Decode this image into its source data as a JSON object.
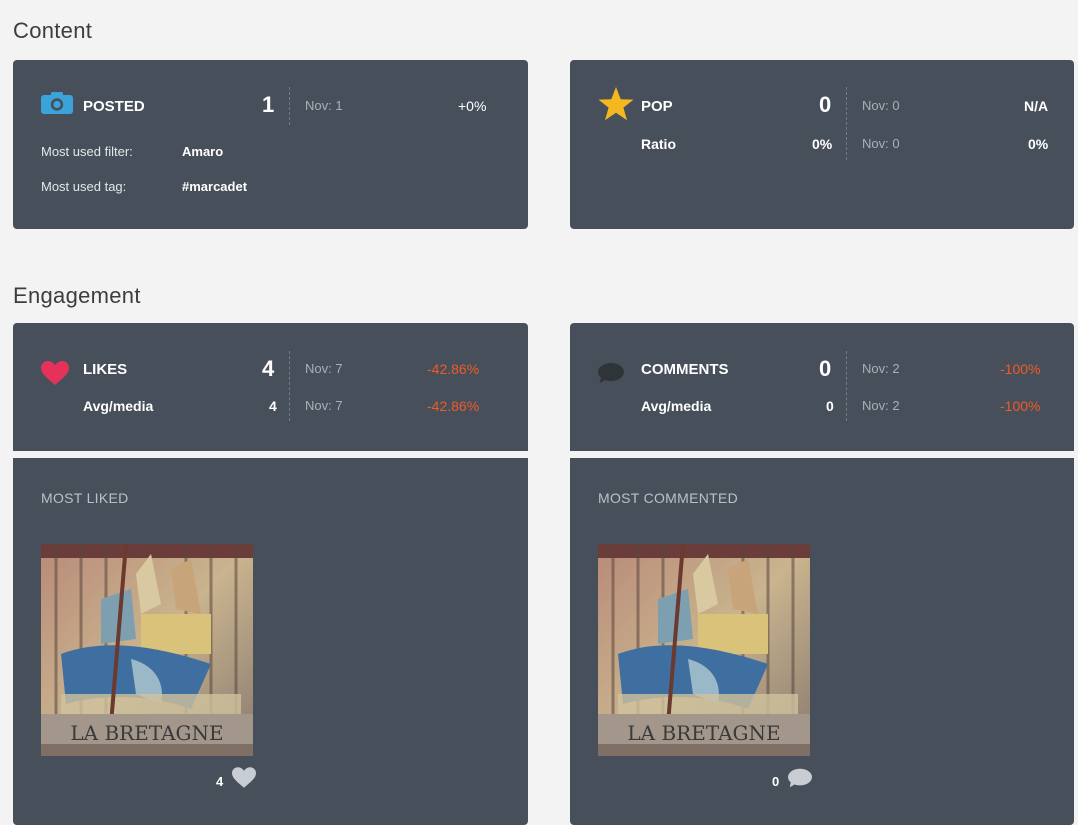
{
  "content_section": {
    "title": "Content",
    "posted": {
      "label": "POSTED",
      "value": "1",
      "compare": "Nov: 1",
      "change": "+0%",
      "filter_label": "Most used filter:",
      "filter_value": "Amaro",
      "tag_label": "Most used tag:",
      "tag_value": "#marcadet"
    },
    "pop": {
      "label": "POP",
      "value": "0",
      "compare": "Nov: 0",
      "change": "N/A",
      "ratio_label": "Ratio",
      "ratio_value": "0%",
      "ratio_compare": "Nov: 0",
      "ratio_change": "0%"
    }
  },
  "engagement_section": {
    "title": "Engagement",
    "likes": {
      "label": "LIKES",
      "value": "4",
      "compare": "Nov: 7",
      "change": "-42.86%",
      "avg_label": "Avg/media",
      "avg_value": "4",
      "avg_compare": "Nov: 7",
      "avg_change": "-42.86%"
    },
    "comments": {
      "label": "COMMENTS",
      "value": "0",
      "compare": "Nov: 2",
      "change": "-100%",
      "avg_label": "Avg/media",
      "avg_value": "0",
      "avg_compare": "Nov: 2",
      "avg_change": "-100%"
    },
    "most_liked": {
      "title": "MOST LIKED",
      "count": "4",
      "photo_caption": "LA BRETAGNE"
    },
    "most_commented": {
      "title": "MOST COMMENTED",
      "count": "0",
      "photo_caption": "LA BRETAGNE"
    }
  },
  "colors": {
    "card_bg": "#47505a",
    "negative": "#f05a28",
    "camera_icon": "#3aa3d9",
    "star_icon": "#f3b81f",
    "heart_icon": "#e6325a",
    "comment_icon": "#2f3439"
  }
}
